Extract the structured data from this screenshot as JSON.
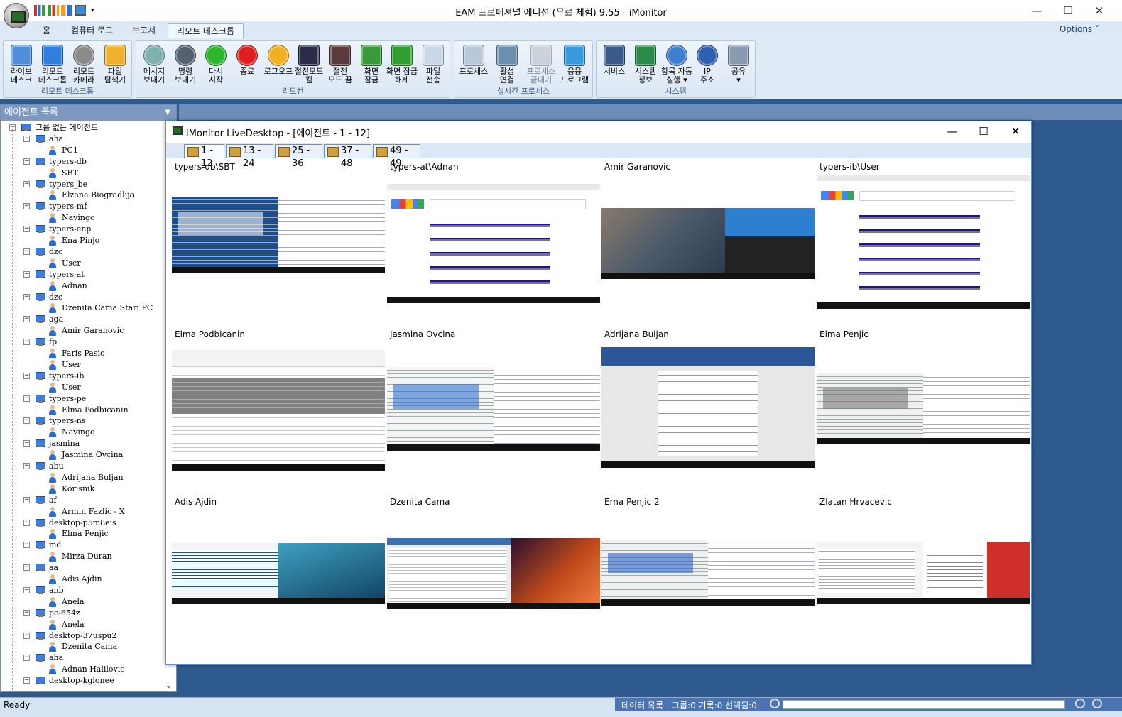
{
  "app": {
    "title": "EAM 프로페셔널 에디션 (무료 체험) 9.55 - iMonitor",
    "window_controls": [
      "—",
      "☐",
      "✕"
    ],
    "options_label": "Options ˅",
    "qat_more": "▾"
  },
  "tabs": [
    {
      "label": "홈"
    },
    {
      "label": "컴퓨터 로그"
    },
    {
      "label": "보고서"
    },
    {
      "label": "리모트 데스크톱",
      "active": true
    }
  ],
  "ribbon": {
    "groups": [
      {
        "label": "리모트 데스크톱",
        "buttons": [
          {
            "label": "라이브\n데스크",
            "icon": "live-desktop-icon",
            "color": "#4f8fd8"
          },
          {
            "label": "리모트\n데스크톱",
            "icon": "remote-desktop-icon",
            "color": "#2f7fe0"
          },
          {
            "label": "리모트\n카메라",
            "icon": "remote-camera-icon",
            "color": "#8a8a8a"
          },
          {
            "label": "파일\n탐색기",
            "icon": "file-explorer-icon",
            "color": "#f0b030"
          }
        ]
      },
      {
        "label": "리모컨",
        "buttons": [
          {
            "label": "메시지\n보내기",
            "icon": "message-icon",
            "color": "#7fb0b0"
          },
          {
            "label": "명령\n보내기",
            "icon": "command-icon",
            "color": "#556070"
          },
          {
            "label": "다시\n시작",
            "icon": "restart-icon",
            "color": "#2db52d"
          },
          {
            "label": "종료",
            "icon": "shutdown-icon",
            "color": "#e02020"
          },
          {
            "label": "로그오프",
            "icon": "logoff-icon",
            "color": "#f0b020"
          },
          {
            "label": "절전모드\n킴",
            "icon": "sleep-on-icon",
            "color": "#2b2b4a"
          },
          {
            "label": "절전\n모드 끔",
            "icon": "sleep-off-icon",
            "color": "#5a3a3a"
          },
          {
            "label": "화면\n잠금",
            "icon": "screen-lock-icon",
            "color": "#3a9a3a"
          },
          {
            "label": "화면 잠금\n해제",
            "icon": "screen-unlock-icon",
            "color": "#2f9f2f"
          },
          {
            "label": "파일\n전송",
            "icon": "file-transfer-icon",
            "color": "#c9d7e7"
          }
        ]
      },
      {
        "label": "실시간 프로세스",
        "buttons": [
          {
            "label": "프로세스",
            "icon": "process-icon",
            "color": "#b8c8d8"
          },
          {
            "label": "활성\n연결",
            "icon": "active-connection-icon",
            "color": "#6f8faf"
          },
          {
            "label": "프로세스\n끝내기",
            "icon": "end-process-icon",
            "color": "#b8bec6",
            "disabled": true
          },
          {
            "label": "응용\n프로그램",
            "icon": "application-icon",
            "color": "#3a9ae0"
          }
        ]
      },
      {
        "label": "시스템",
        "buttons": [
          {
            "label": "서비스",
            "icon": "service-icon",
            "color": "#3a5a8a"
          },
          {
            "label": "시스템\n정보",
            "icon": "system-info-icon",
            "color": "#2a8a4a"
          },
          {
            "label": "항목 자동\n실행 ▾",
            "icon": "autorun-gear-icon",
            "color": "#3f7fd0"
          },
          {
            "label": "IP\n주소",
            "icon": "ip-globe-icon",
            "color": "#2f5fb0"
          },
          {
            "label": "공유\n▾",
            "icon": "share-icon",
            "color": "#8a9ab0"
          }
        ]
      }
    ]
  },
  "agent_panel": {
    "title": "에이전트 목록",
    "root": "그룹 없는 에이전트",
    "groups": [
      {
        "name": "aha",
        "users": [
          "PC1"
        ]
      },
      {
        "name": "typers-db",
        "users": [
          "SBT"
        ]
      },
      {
        "name": "typers_be",
        "users": [
          "Elzana Biogradlija"
        ]
      },
      {
        "name": "typers-mf",
        "users": [
          "Navingo"
        ]
      },
      {
        "name": "typers-enp",
        "users": [
          "Ena Pinjo"
        ]
      },
      {
        "name": "dzc",
        "users": [
          "User"
        ]
      },
      {
        "name": "typers-at",
        "users": [
          "Adnan"
        ]
      },
      {
        "name": "dzc",
        "users": [
          "Dzenita Cama Stari PC"
        ]
      },
      {
        "name": "aga",
        "users": [
          "Amir Garanovic"
        ]
      },
      {
        "name": "fp",
        "users": [
          "Faris Pasic",
          "User"
        ]
      },
      {
        "name": "typers-ib",
        "users": [
          "User"
        ]
      },
      {
        "name": "typers-pe",
        "users": [
          "Elma Podbicanin"
        ]
      },
      {
        "name": "typers-ns",
        "users": [
          "Navingo"
        ]
      },
      {
        "name": "jasmina",
        "users": [
          "Jasmina Ovcina"
        ]
      },
      {
        "name": "abu",
        "users": [
          "Adrijana Buljan",
          "Korisnik"
        ]
      },
      {
        "name": "af",
        "users": [
          "Armin Fazlic - X"
        ]
      },
      {
        "name": "desktop-p5m8eis",
        "users": [
          "Elma Penjic"
        ]
      },
      {
        "name": "md",
        "users": [
          "Mirza Duran"
        ]
      },
      {
        "name": "aa",
        "users": [
          "Adis Ajdin"
        ]
      },
      {
        "name": "anb",
        "users": [
          "Anela"
        ]
      },
      {
        "name": "pc-654z",
        "users": [
          "Anela"
        ]
      },
      {
        "name": "desktop-37uspu2",
        "users": [
          "Dzenita Cama"
        ]
      },
      {
        "name": "aha",
        "users": [
          "Adnan Halilovic"
        ]
      },
      {
        "name": "desktop-kglonee",
        "users": []
      }
    ]
  },
  "live_desktop": {
    "title": "iMonitor LiveDesktop - [에이전트 - 1 - 12]",
    "page_tabs": [
      "1 - 12",
      "13 - 24",
      "25 - 36",
      "37 - 48",
      "49 - 49"
    ],
    "active_page": 0,
    "tiles": [
      {
        "label": "typers-db\\SBT",
        "palette": [
          "#1d4e8f",
          "#f3f5f8",
          "#3ea0c8",
          "#e8e8e8"
        ],
        "theme": "dual-light"
      },
      {
        "label": "typers-at\\Adnan",
        "palette": [
          "#ffffff",
          "#4285f4",
          "#1a0dab",
          "#ea4335"
        ],
        "theme": "google"
      },
      {
        "label": "Amir Garanovic",
        "palette": [
          "#6a5a4a",
          "#3a4a5a",
          "#2f7fd0",
          "#222222"
        ],
        "theme": "dual-photo"
      },
      {
        "label": "typers-ib\\User",
        "palette": [
          "#ffffff",
          "#4285f4",
          "#1a0dab",
          "#dd2222"
        ],
        "theme": "google"
      },
      {
        "label": "Elma Podbicanin",
        "palette": [
          "#ffffff",
          "#1f6e3a",
          "#808080",
          "#c8c8c8"
        ],
        "theme": "excel"
      },
      {
        "label": "Jasmina Ovcina",
        "palette": [
          "#f4f4f4",
          "#2f6fd0",
          "#1a1a1a",
          "#d8e4f2"
        ],
        "theme": "dual-dark"
      },
      {
        "label": "Adrijana Buljan",
        "palette": [
          "#2b579a",
          "#ffffff",
          "#e8e8e8",
          "#333333"
        ],
        "theme": "word"
      },
      {
        "label": "Elma Penjic",
        "palette": [
          "#f0f0f0",
          "#777777",
          "#2a62c9",
          "#000000"
        ],
        "theme": "dual-dark"
      },
      {
        "label": "Adis Ajdin",
        "palette": [
          "#f0f4f8",
          "#1f4f86",
          "#1f7fa0",
          "#0f3f60"
        ],
        "theme": "split-ocean"
      },
      {
        "label": "Dzenita Cama",
        "palette": [
          "#e9edf2",
          "#3a6fb0",
          "#c04a1a",
          "#2a1030"
        ],
        "theme": "split-canyon"
      },
      {
        "label": "Erna Penjic 2",
        "palette": [
          "#f0f0f0",
          "#2a62c9",
          "#222222",
          "#b88f70"
        ],
        "theme": "dual-dark"
      },
      {
        "label": "Zlatan Hrvacevic",
        "palette": [
          "#f4f4f4",
          "#2a62c9",
          "#d0302a",
          "#1a1a1a"
        ],
        "theme": "dual-red"
      }
    ]
  },
  "status": {
    "ready": "Ready",
    "data_list": "데이터 목록 - 그룹:0  기록:0  선택됨:0"
  }
}
